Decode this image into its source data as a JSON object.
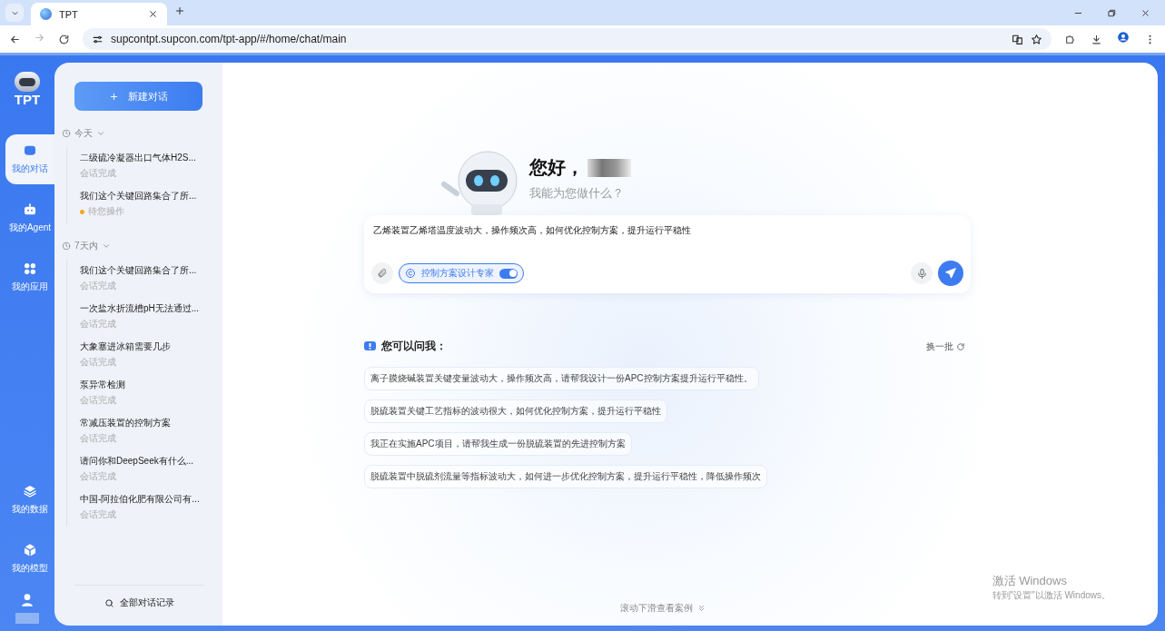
{
  "browser": {
    "tab_title": "TPT",
    "url": "supcontpt.supcon.com/tpt-app/#/home/chat/main"
  },
  "app": {
    "logo": "TPT"
  },
  "nav": [
    {
      "label": "我的对话",
      "selected": true
    },
    {
      "label": "我的Agent",
      "selected": false
    },
    {
      "label": "我的应用",
      "selected": false
    }
  ],
  "nav_bottom": [
    {
      "label": "我的数据",
      "selected": false
    },
    {
      "label": "我的模型",
      "selected": false
    }
  ],
  "sidebar": {
    "new_chat": "新建对话",
    "all_history": "全部对话记录",
    "groups": [
      {
        "label": "今天",
        "expanded": true,
        "children": [
          {
            "title": "二级硫冷凝器出口气体H2S...",
            "status": "会话完成",
            "pending": false
          },
          {
            "title": "我们这个关键回路集合了所...",
            "status": "待您操作",
            "pending": true
          }
        ]
      },
      {
        "label": "7天内",
        "expanded": true,
        "children": [
          {
            "title": "我们这个关键回路集合了所...",
            "status": "会话完成",
            "pending": false
          },
          {
            "title": "一次盐水折流槽pH无法通过...",
            "status": "会话完成",
            "pending": false
          },
          {
            "title": "大象塞进冰箱需要几步",
            "status": "会话完成",
            "pending": false
          },
          {
            "title": "泵异常检测",
            "status": "会话完成",
            "pending": false
          },
          {
            "title": "常减压装置的控制方案",
            "status": "会话完成",
            "pending": false
          },
          {
            "title": "请问你和DeepSeek有什么...",
            "status": "会话完成",
            "pending": false
          },
          {
            "title": "中国-阿拉伯化肥有限公司有...",
            "status": "会话完成",
            "pending": false
          }
        ]
      }
    ]
  },
  "greeting": {
    "title": "您好，",
    "subtitle": "我能为您做什么？"
  },
  "input": {
    "value": "乙烯装置乙烯塔温度波动大，操作频次高，如何优化控制方案，提升运行平稳性",
    "agent_chip": "控制方案设计专家",
    "agent_on": true
  },
  "suggestions": {
    "title": "您可以问我：",
    "refresh": "换一批",
    "items": [
      "离子膜烧碱装置关键变量波动大，操作频次高，请帮我设计一份APC控制方案提升运行平稳性。",
      "脱硫装置关键工艺指标的波动很大，如何优化控制方案，提升运行平稳性",
      "我正在实施APC项目，请帮我生成一份脱硫装置的先进控制方案",
      "脱硫装置中脱硫剂流量等指标波动大，如何进一步优化控制方案，提升运行平稳性，降低操作频次"
    ]
  },
  "scroll_hint": "滚动下滑查看案例",
  "activation": {
    "title": "激活 Windows",
    "subtitle": "转到\"设置\"以激活 Windows。"
  }
}
